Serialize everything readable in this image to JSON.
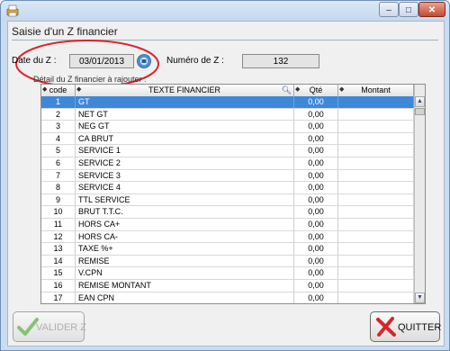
{
  "window": {
    "close_glyph": "✕",
    "max_glyph": "□",
    "min_glyph": "–"
  },
  "form": {
    "title": "Saisie d'un Z financier",
    "date_label": "Date du Z :",
    "date_value": "03/01/2013",
    "number_label": "Numéro de Z :",
    "number_value": "132",
    "detail_label": "Détail du Z financier à rajouter :"
  },
  "grid": {
    "columns": {
      "code": "code",
      "text": "TEXTE FINANCIER",
      "qty": "Qté",
      "amount": "Montant"
    },
    "rows": [
      {
        "code": "1",
        "text": "GT",
        "qty": "0,00",
        "amount": ""
      },
      {
        "code": "2",
        "text": "NET GT",
        "qty": "0,00",
        "amount": ""
      },
      {
        "code": "3",
        "text": "NEG GT",
        "qty": "0,00",
        "amount": ""
      },
      {
        "code": "4",
        "text": "CA BRUT",
        "qty": "0,00",
        "amount": ""
      },
      {
        "code": "5",
        "text": "SERVICE 1",
        "qty": "0,00",
        "amount": ""
      },
      {
        "code": "6",
        "text": "SERVICE 2",
        "qty": "0,00",
        "amount": ""
      },
      {
        "code": "7",
        "text": "SERVICE 3",
        "qty": "0,00",
        "amount": ""
      },
      {
        "code": "8",
        "text": "SERVICE 4",
        "qty": "0,00",
        "amount": ""
      },
      {
        "code": "9",
        "text": "TTL SERVICE",
        "qty": "0,00",
        "amount": ""
      },
      {
        "code": "10",
        "text": "BRUT T.T.C.",
        "qty": "0,00",
        "amount": ""
      },
      {
        "code": "11",
        "text": "HORS CA+",
        "qty": "0,00",
        "amount": ""
      },
      {
        "code": "12",
        "text": "HORS CA-",
        "qty": "0,00",
        "amount": ""
      },
      {
        "code": "13",
        "text": "TAXE %+",
        "qty": "0,00",
        "amount": ""
      },
      {
        "code": "14",
        "text": "REMISE",
        "qty": "0,00",
        "amount": ""
      },
      {
        "code": "15",
        "text": "V.CPN",
        "qty": "0,00",
        "amount": ""
      },
      {
        "code": "16",
        "text": "REMISE MONTANT",
        "qty": "0,00",
        "amount": ""
      },
      {
        "code": "17",
        "text": "EAN CPN",
        "qty": "0,00",
        "amount": ""
      }
    ],
    "selected_row_code": "1"
  },
  "buttons": {
    "validate": "VALIDER Z",
    "quit": "QUITTER"
  },
  "colors": {
    "selection": "#3f88d8",
    "highlight_oval": "#d9262b",
    "validate_check": "#5fb64a",
    "quit_x": "#d8262b"
  },
  "icons": {
    "app": "printer-icon",
    "calendar": "calendar-icon",
    "validate": "checkmark-icon",
    "quit": "red-x-icon",
    "delete": "trash-icon"
  }
}
